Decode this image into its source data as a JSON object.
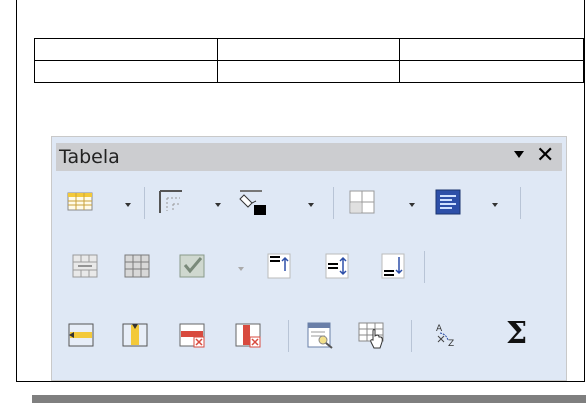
{
  "toolbar": {
    "title": "Tabela",
    "menu_icon": "dropdown-arrow-icon",
    "close_icon": "close-icon",
    "close_glyph": "✕",
    "sigma_glyph": "Σ"
  },
  "document": {
    "table_rows": 2,
    "table_cols": 3
  },
  "buttons": [
    "insert-table-icon",
    "borders-icon",
    "border-style-icon",
    "background-color-icon",
    "merge-cells-icon",
    "split-cells-icon",
    "protect-icon",
    "align-top-icon",
    "center-vertical-icon",
    "align-bottom-icon",
    "insert-rows-icon",
    "insert-columns-icon",
    "delete-rows-icon",
    "delete-columns-icon",
    "autoformat-icon",
    "table-properties-icon",
    "sort-icon",
    "sum-icon"
  ],
  "colors": {
    "toolbar_bg": "#dfe8f5",
    "title_bg": "#cccdd0",
    "accent_yellow": "#f3c93a",
    "accent_red": "#d84a3e",
    "accent_blue": "#2d4fa8"
  }
}
